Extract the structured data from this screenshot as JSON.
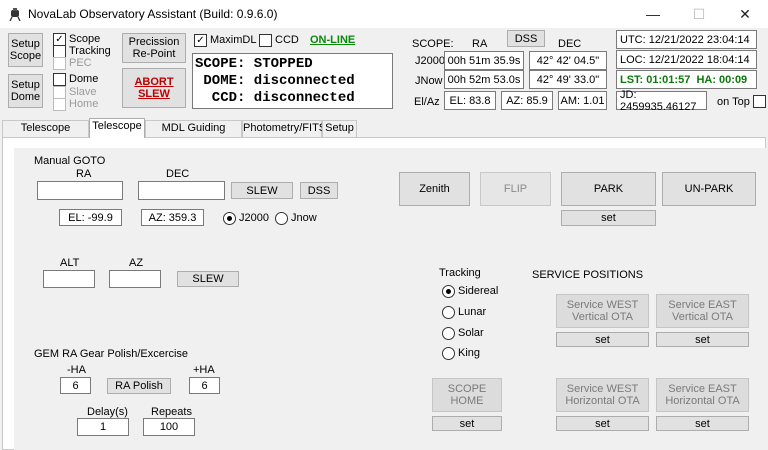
{
  "window": {
    "title": "NovaLab Observatory Assistant (Build: 0.9.6.0)",
    "min_glyph": "—",
    "max_glyph": "☐",
    "close_glyph": "✕"
  },
  "left_panel": {
    "setup_scope": "Setup\nScope",
    "setup_dome": "Setup\nDome",
    "scope_label": "Scope",
    "tracking_label": "Tracking",
    "pec_label": "PEC",
    "dome_label": "Dome",
    "slave_label": "Slave",
    "home_label": "Home",
    "precision_repoint": "Precission\nRe-Point",
    "abort_slew": "ABORT\nSLEW",
    "scope_checked": true,
    "tracking_checked": false,
    "dome_checked": false
  },
  "connection": {
    "maximdl_label": "MaximDL",
    "ccd_label": "CCD",
    "online": "ON-LINE",
    "maximdl_checked": true,
    "ccd_checked": false
  },
  "status_lines": [
    "SCOPE: STOPPED",
    " DOME: disconnected",
    "  CCD: disconnected"
  ],
  "coords": {
    "scope_label": "SCOPE:",
    "ra_header": "RA",
    "dss_button": "DSS",
    "dec_header": "DEC",
    "j2000_label": "J2000",
    "jnow_label": "JNow",
    "elaz_label": "El/Az",
    "j2000_ra": "00h 51m 35.9s",
    "j2000_dec": "42° 42' 04.5\"",
    "jnow_ra": "00h 52m 53.0s",
    "jnow_dec": "42° 49' 33.0\"",
    "el": "EL: 83.8",
    "az": "AZ: 85.9",
    "am": "AM: 1.01"
  },
  "times": {
    "utc": "UTC: 12/21/2022 23:04:14",
    "loc": "LOC: 12/21/2022 18:04:14",
    "lst": "LST: 01:01:57",
    "ha": "HA: 00:09",
    "jd": "JD: 2459935.46127",
    "on_top_label": "on Top",
    "lst_color": "#0a7a0a"
  },
  "tabs": [
    {
      "label": "Telescope Memory",
      "active": false
    },
    {
      "label": "Telescope",
      "active": true
    },
    {
      "label": "MDL Guiding Monitor",
      "active": false
    },
    {
      "label": "Photometry/FITS",
      "active": false
    },
    {
      "label": "Setup",
      "active": false
    }
  ],
  "telescope": {
    "manual_goto_label": "Manual GOTO",
    "ra_label": "RA",
    "dec_label": "DEC",
    "ra_value": "",
    "dec_value": "",
    "slew_button": "SLEW",
    "dss_button": "DSS",
    "el_readout": "EL: -99.9",
    "az_readout": "AZ: 359.3",
    "j2000_radio": "J2000",
    "jnow_radio": "Jnow",
    "epoch_selected": "J2000",
    "alt_label": "ALT",
    "az_label": "AZ",
    "alt_value": "",
    "az_value": "",
    "altaz_slew_button": "SLEW",
    "gem_label": "GEM RA Gear Polish/Excercise",
    "minus_ha_label": "-HA",
    "plus_ha_label": "+HA",
    "minus_ha_value": "6",
    "plus_ha_value": "6",
    "ra_polish_button": "RA Polish",
    "delay_label": "Delay(s)",
    "repeats_label": "Repeats",
    "delay_value": "1",
    "repeats_value": "100",
    "zenith_button": "Zenith",
    "flip_button": "FLIP",
    "park_button": "PARK",
    "unpark_button": "UN-PARK",
    "park_set_button": "set",
    "tracking_label": "Tracking",
    "tracking_options": [
      "Sidereal",
      "Lunar",
      "Solar",
      "King"
    ],
    "tracking_selected": "Sidereal",
    "service_positions_label": "SERVICE POSITIONS",
    "svc_west_vertical": "Service WEST\nVertical OTA",
    "svc_east_vertical": "Service EAST\nVertical OTA",
    "svc_west_horizontal": "Service WEST\nHorizontal OTA",
    "svc_east_horizontal": "Service EAST\nHorizontal OTA",
    "scope_home": "SCOPE\nHOME",
    "set_label": "set"
  }
}
